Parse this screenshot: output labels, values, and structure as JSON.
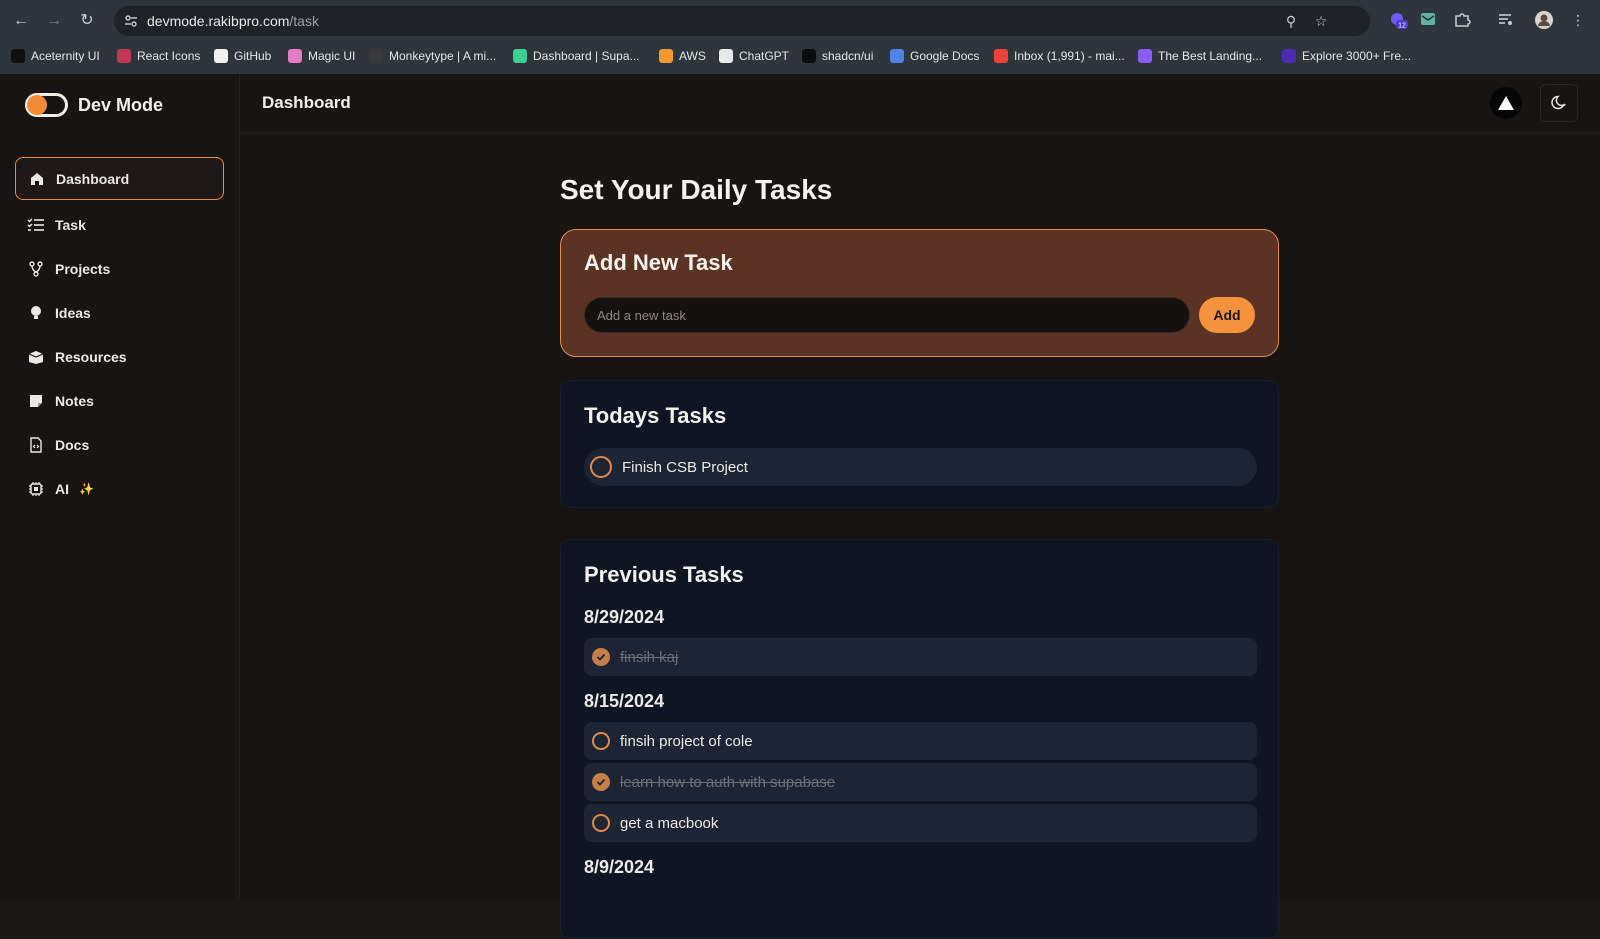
{
  "browser": {
    "url_domain": "devmode.rakibpro.com",
    "url_path": "/task",
    "extension_badge": "12",
    "bookmarks": [
      {
        "label": "Aceternity UI",
        "color": "#111111"
      },
      {
        "label": "React Icons",
        "color": "#c2365a"
      },
      {
        "label": "GitHub",
        "color": "#f0f0f0"
      },
      {
        "label": "Magic UI",
        "color": "#e879c7"
      },
      {
        "label": "Monkeytype | A mi...",
        "color": "#3a3a3a"
      },
      {
        "label": "Dashboard | Supa...",
        "color": "#3ecf8e"
      },
      {
        "label": "AWS",
        "color": "#f29a2e"
      },
      {
        "label": "ChatGPT",
        "color": "#e8e8e8"
      },
      {
        "label": "shadcn/ui",
        "color": "#0b0b0b"
      },
      {
        "label": "Google Docs",
        "color": "#4a86e8"
      },
      {
        "label": "Inbox (1,991) - mai...",
        "color": "#ea4335"
      },
      {
        "label": "The Best Landing...",
        "color": "#8b5cf6"
      },
      {
        "label": "Explore 3000+ Fre...",
        "color": "#4b2bb0"
      }
    ]
  },
  "app": {
    "brand": "Dev Mode",
    "accent": "#f5923c",
    "sidebar": {
      "items": [
        {
          "label": "Dashboard",
          "icon": "home-icon",
          "active": true
        },
        {
          "label": "Task",
          "icon": "list-icon"
        },
        {
          "label": "Projects",
          "icon": "branch-icon"
        },
        {
          "label": "Ideas",
          "icon": "bulb-icon"
        },
        {
          "label": "Resources",
          "icon": "box-icon"
        },
        {
          "label": "Notes",
          "icon": "note-icon"
        },
        {
          "label": "Docs",
          "icon": "doc-code-icon"
        },
        {
          "label": "AI",
          "icon": "chip-icon",
          "badge": "✨"
        }
      ]
    },
    "topbar": {
      "title": "Dashboard"
    },
    "main": {
      "heading": "Set Your Daily Tasks",
      "add_card": {
        "title": "Add New Task",
        "input_placeholder": "Add a new task",
        "button_label": "Add"
      },
      "today": {
        "title": "Todays Tasks",
        "tasks": [
          {
            "text": "Finish CSB Project",
            "done": false
          }
        ]
      },
      "previous": {
        "title": "Previous Tasks",
        "groups": [
          {
            "date": "8/29/2024",
            "tasks": [
              {
                "text": "finsih kaj",
                "done": true
              }
            ]
          },
          {
            "date": "8/15/2024",
            "tasks": [
              {
                "text": "finsih project of cole",
                "done": false
              },
              {
                "text": "learn how to auth with supabase",
                "done": true
              },
              {
                "text": "get a macbook",
                "done": false
              }
            ]
          },
          {
            "date": "8/9/2024",
            "tasks": []
          }
        ]
      }
    }
  }
}
